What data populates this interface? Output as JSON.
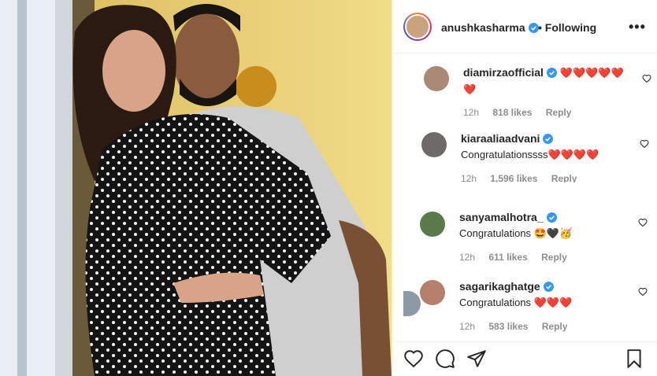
{
  "post": {
    "author": "anushkasharma",
    "follow_status": "Following",
    "more_label": "•••"
  },
  "comments": [
    {
      "username": "diamirzaofficial",
      "text": "❤️❤️❤️❤️❤️❤️",
      "time": "12h",
      "likes": "818 likes",
      "reply": "Reply"
    },
    {
      "username": "kiaraaliaadvani",
      "text": "Congratulationssss❤️❤️❤️❤️",
      "time": "12h",
      "likes": "1,596 likes",
      "reply": "Reply"
    },
    {
      "username": "sanyamalhotra_",
      "text": "Congratulations 🤩🖤🥳",
      "time": "12h",
      "likes": "611 likes",
      "reply": "Reply"
    },
    {
      "username": "sagarikaghatge",
      "text": "Congratulations ❤️❤️❤️",
      "time": "12h",
      "likes": "583 likes",
      "reply": "Reply"
    }
  ],
  "icons": {
    "like": "heart-icon",
    "comment": "comment-icon",
    "share": "share-icon",
    "save": "bookmark-icon"
  },
  "colors": {
    "heart_red": "#ed4956",
    "verified_blue": "#3897f0",
    "meta_gray": "#8e8e8e"
  }
}
